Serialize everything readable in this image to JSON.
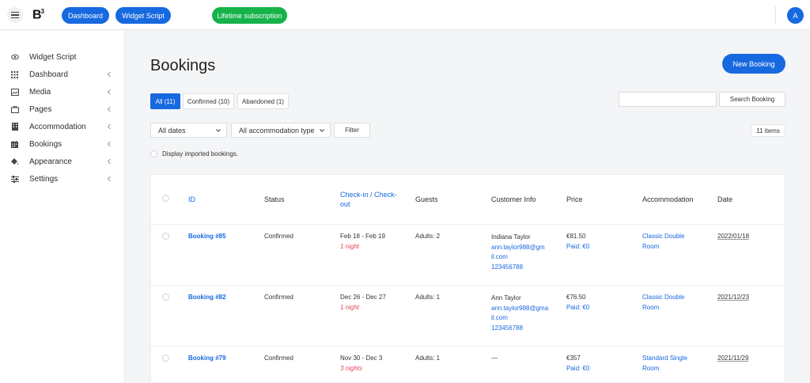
{
  "topbar": {
    "logo": "B",
    "logo_sup": "3",
    "dashboard_label": "Dashboard",
    "widget_label": "Widget Script",
    "lifetime_label": "Lifetime subscription",
    "avatar_letter": "A"
  },
  "sidebar": {
    "items": [
      {
        "label": "Widget Script",
        "icon": "eye-icon"
      },
      {
        "label": "Dashboard",
        "icon": "grid-icon"
      },
      {
        "label": "Media",
        "icon": "image-icon"
      },
      {
        "label": "Pages",
        "icon": "folder-icon"
      },
      {
        "label": "Accommodation",
        "icon": "building-icon"
      },
      {
        "label": "Bookings",
        "icon": "calendar-icon"
      },
      {
        "label": "Appearance",
        "icon": "paint-bucket-icon"
      },
      {
        "label": "Settings",
        "icon": "sliders-icon"
      }
    ]
  },
  "main": {
    "title": "Bookings",
    "new_booking_label": "New Booking",
    "tabs": [
      {
        "label": "All (11)"
      },
      {
        "label": "Confirmed (10)"
      },
      {
        "label": "Abandoned (1)"
      }
    ],
    "search_placeholder": "",
    "search_button": "Search Booking",
    "filter_dates": "All dates",
    "filter_accommodation": "All accommodation type",
    "filter_button": "Filter",
    "item_count": "11 items",
    "imported_label": "Display imported bookings."
  },
  "table": {
    "headers": {
      "id": "ID",
      "status": "Status",
      "checkin_1": "Check-in / Check-",
      "checkin_2": "out",
      "guests": "Guests",
      "customer": "Customer Info",
      "price": "Price",
      "accommodation": "Accommodation",
      "date": "Date"
    },
    "rows": [
      {
        "id": "Booking #85",
        "status": "Confirmed",
        "dates": "Feb 18 - Feb 19",
        "nights": "1 night",
        "guests": "Adults: 2",
        "customer_name": "Indiana Taylor",
        "email_1": "ann.taylor988@gm",
        "email_2": "il.com",
        "phone": "123456788",
        "price": "€81.50",
        "paid": "Paid: €0",
        "acc_1": "Classic Double",
        "acc_2": "Room",
        "date": "2022/01/18"
      },
      {
        "id": "Booking #82",
        "status": "Confirmed",
        "dates": "Dec 26 - Dec 27",
        "nights": "1 night",
        "guests": "Adults: 1",
        "customer_name": "Ann Taylor",
        "email_1": "ann.taylor988@gma",
        "email_2": "il.com",
        "phone": "123456788",
        "price": "€76.50",
        "paid": "Paid: €0",
        "acc_1": "Classic Double",
        "acc_2": "Room",
        "date": "2021/12/23"
      },
      {
        "id": "Booking #79",
        "status": "Confirmed",
        "dates": "Nov 30 - Dec 3",
        "nights": "3 nights",
        "guests": "Adults: 1",
        "customer_name": "—",
        "email_1": "",
        "email_2": "",
        "phone": "",
        "price": "€357",
        "paid": "Paid: €0",
        "acc_1": "Standard Single",
        "acc_2": "Room",
        "date": "2021/11/29"
      }
    ]
  },
  "colors": {
    "accent": "#1769e0",
    "success": "#16b34a",
    "nights": "#e0455a"
  }
}
